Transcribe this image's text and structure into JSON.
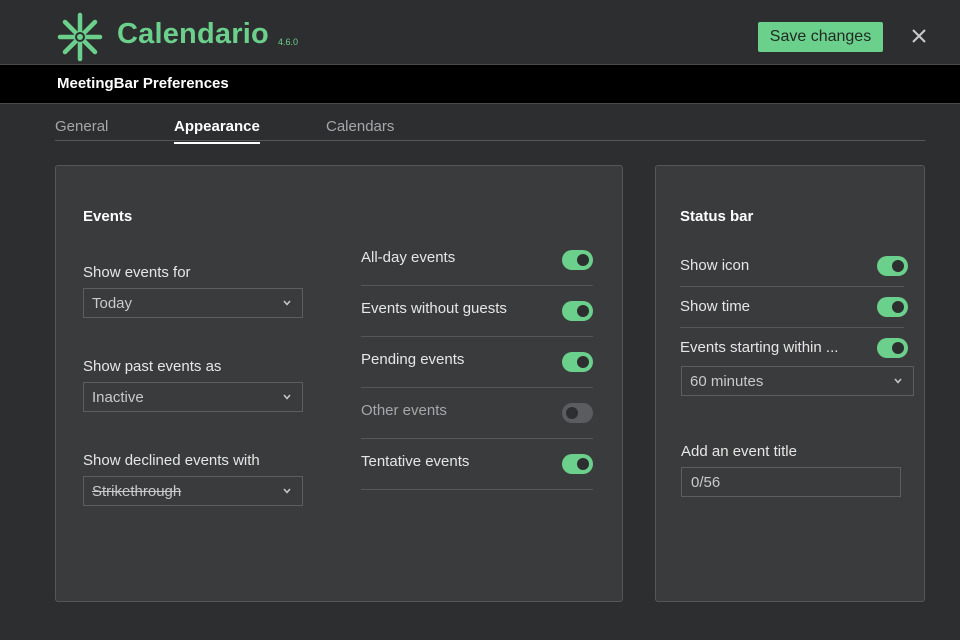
{
  "app": {
    "name": "Calendario",
    "version": "4.6.0",
    "brand_color": "#6bd08b",
    "save_label": "Save changes",
    "close_icon": "close-icon"
  },
  "titlebar": {
    "title": "MeetingBar Preferences"
  },
  "tabs": [
    {
      "label": "General",
      "active": false
    },
    {
      "label": "Appearance",
      "active": true
    },
    {
      "label": "Calendars",
      "active": false
    }
  ],
  "events": {
    "title": "Events",
    "show_events_for": {
      "label": "Show events for",
      "value": "Today"
    },
    "show_past_as": {
      "label": "Show past events as",
      "value": "Inactive"
    },
    "show_declined_with": {
      "label": "Show declined events with",
      "value": "Strikethrough"
    },
    "toggles": [
      {
        "label": "All-day events",
        "on": true
      },
      {
        "label": "Events without guests",
        "on": true
      },
      {
        "label": "Pending events",
        "on": true
      },
      {
        "label": "Other events",
        "on": false
      },
      {
        "label": "Tentative events",
        "on": true
      }
    ]
  },
  "status_bar": {
    "title": "Status bar",
    "toggles": [
      {
        "label": "Show icon",
        "on": true
      },
      {
        "label": "Show time",
        "on": true
      },
      {
        "label": "Events starting within ...",
        "on": true
      }
    ],
    "within_value": "60 minutes",
    "event_title_label": "Add an event title",
    "event_title_value": "0/56"
  }
}
